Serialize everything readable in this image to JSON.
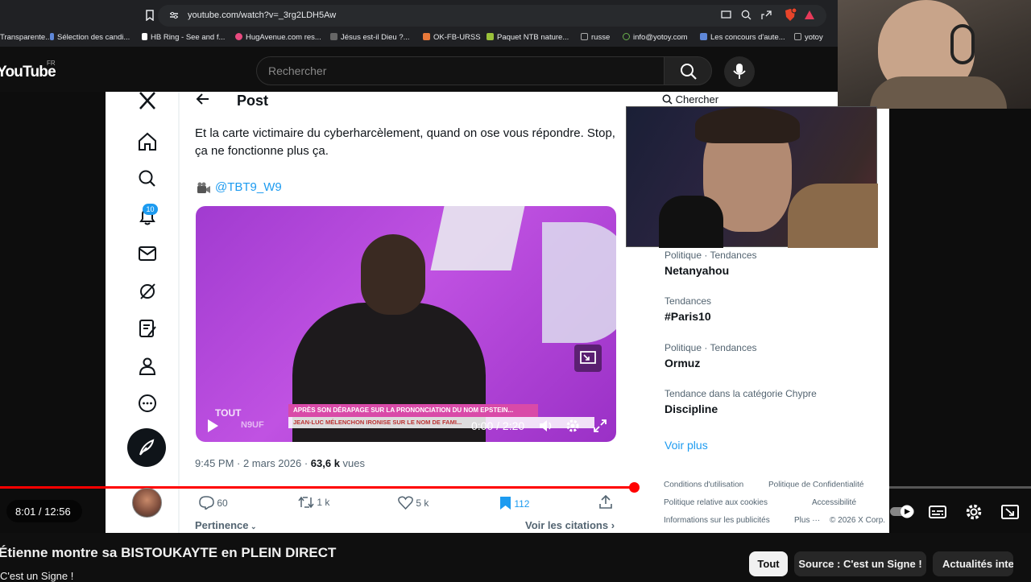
{
  "browser": {
    "url": "youtube.com/watch?v=_3rg2LDH5Aw",
    "bookmarks": [
      {
        "label": "Transparente...",
        "color": "#888"
      },
      {
        "label": "Sélection des candi...",
        "color": "#5f87d8"
      },
      {
        "label": "HB Ring - See and f...",
        "color": "#fff"
      },
      {
        "label": "HugAvenue.com res...",
        "color": "#e84a7f"
      },
      {
        "label": "Jésus est-il Dieu ?...",
        "color": "#888"
      },
      {
        "label": "OK-FB-URSS",
        "color": "#e8793a"
      },
      {
        "label": "Paquet NTB nature...",
        "color": "#9ac13a"
      },
      {
        "label": "russe",
        "color": "#aaa"
      },
      {
        "label": "info@yotoy.com",
        "color": "#6ab04c"
      },
      {
        "label": "Les concours d'aute...",
        "color": "#5f87d8"
      },
      {
        "label": "yotoy",
        "color": "#aaa"
      }
    ]
  },
  "youtube": {
    "logo": "YouTube",
    "country": "FR",
    "search_placeholder": "Rechercher"
  },
  "x": {
    "post_title": "Post",
    "notif_count": "10",
    "tweet_text": "Et la carte victimaire du cyberharcèlement, quand on ose vous répondre. Stop, ça ne fonctionne plus ça.",
    "handle": "@TBT9_W9",
    "media_banner_1": "APRÈS SON DÉRAPAGE SUR LA PRONONCIATION DU NOM EPSTEIN...",
    "media_banner_2": "JEAN-LUC MÉLENCHON IRONISE SUR LE NOM DE FAMI...",
    "media_logo_1": "TOUT",
    "media_logo_2": "N9UF",
    "media_time": "0:00 / 2:20",
    "meta_time": "9:45 PM · 2 mars 2026 · ",
    "meta_views": "63,6 k",
    "meta_views_label": " vues",
    "actions": {
      "replies": "60",
      "reposts": "1 k",
      "likes": "5 k",
      "bookmarks": "112"
    },
    "pertinence": "Pertinence",
    "voir_citations": "Voir les citations",
    "search_label": "Chercher",
    "trends": [
      {
        "category": "Politique · Tendances",
        "name": "Netanyahou"
      },
      {
        "category": "Tendances",
        "name": "#Paris10"
      },
      {
        "category": "Politique · Tendances",
        "name": "Ormuz"
      },
      {
        "category": "Tendance dans la catégorie Chypre",
        "name": "Discipline"
      }
    ],
    "voir_plus": "Voir plus",
    "footer": {
      "conditions": "Conditions d'utilisation",
      "confidentialite": "Politique de Confidentialité",
      "cookies": "Politique relative aux cookies",
      "accessibilite": "Accessibilité",
      "publicites": "Informations sur les publicités",
      "plus": "Plus ···",
      "copyright": "© 2026 X Corp."
    }
  },
  "player": {
    "time": "8:01 / 12:56",
    "progress": 0.615
  },
  "video": {
    "title": "Étienne montre sa BISTOUKAYTE en PLEIN DIRECT",
    "channel": "C'est un Signe !",
    "chips": [
      "Tout",
      "Source : C'est un Signe !",
      "Actualités inte"
    ]
  },
  "colors": {
    "accent": "#ff0000",
    "x_blue": "#1d9bf0"
  }
}
